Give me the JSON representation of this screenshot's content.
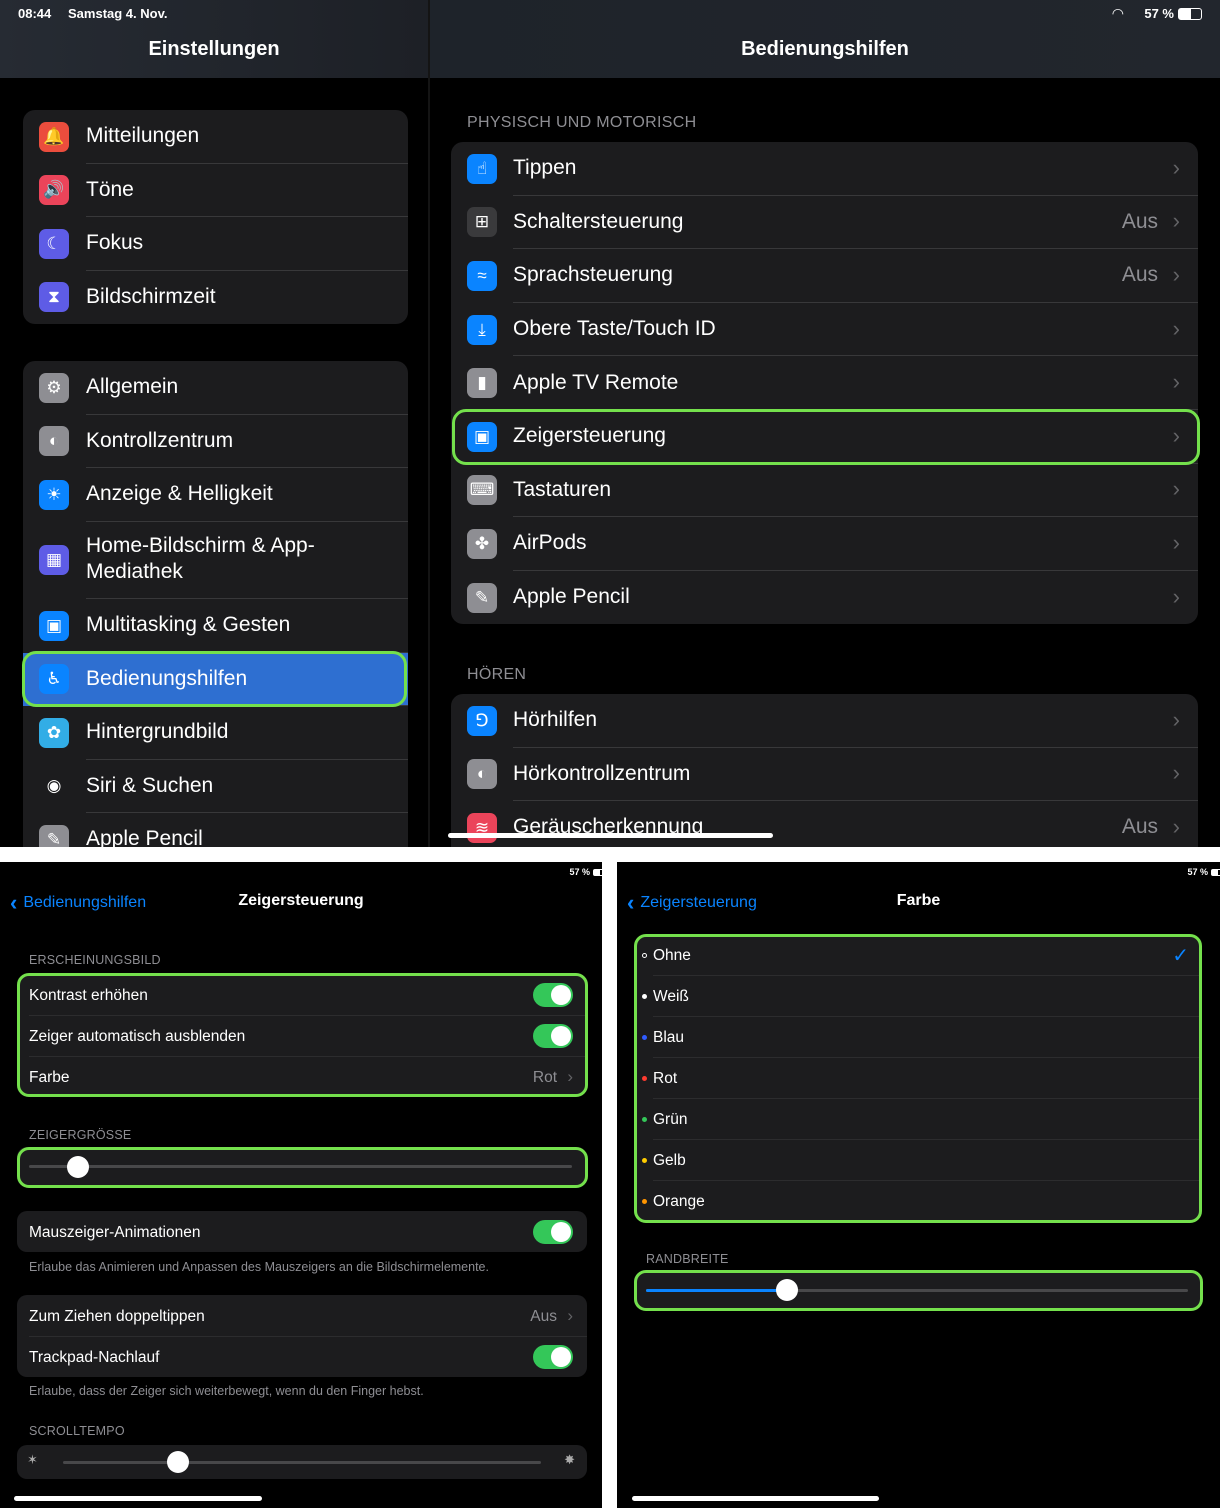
{
  "top": {
    "status": {
      "time": "08:44",
      "date": "Samstag 4. Nov.",
      "battery": "57 %"
    },
    "sidebar_title": "Einstellungen",
    "detail_title": "Bedienungshilfen",
    "sidebar_group1": [
      {
        "label": "Mitteilungen",
        "icon": "bell-icon",
        "color": "#eb4d3d"
      },
      {
        "label": "Töne",
        "icon": "speaker-icon",
        "color": "#eb445a"
      },
      {
        "label": "Fokus",
        "icon": "moon-icon",
        "color": "#5e5ce6"
      },
      {
        "label": "Bildschirmzeit",
        "icon": "hourglass-icon",
        "color": "#5e5ce6"
      }
    ],
    "sidebar_group2": [
      {
        "label": "Allgemein",
        "icon": "gear-icon",
        "color": "#8e8e93"
      },
      {
        "label": "Kontrollzentrum",
        "icon": "switches-icon",
        "color": "#8e8e93"
      },
      {
        "label": "Anzeige & Helligkeit",
        "icon": "sun-icon",
        "color": "#0a84ff"
      },
      {
        "label": "Home-Bildschirm & App-",
        "label2": "Mediathek",
        "icon": "grid-icon",
        "color": "#5e5ce6"
      },
      {
        "label": "Multitasking & Gesten",
        "icon": "multitask-icon",
        "color": "#0a84ff"
      },
      {
        "label": "Bedienungshilfen",
        "icon": "accessibility-icon",
        "color": "#0a84ff"
      },
      {
        "label": "Hintergrundbild",
        "icon": "flower-icon",
        "color": "#32ade6"
      },
      {
        "label": "Siri & Suchen",
        "icon": "siri-icon",
        "color": "#1c1c1e"
      },
      {
        "label": "Apple Pencil",
        "icon": "pencil-icon",
        "color": "#8e8e93"
      }
    ],
    "section_motor": "PHYSISCH UND MOTORISCH",
    "motor_items": [
      {
        "label": "Tippen",
        "value": "",
        "icon": "hand-tap-icon",
        "color": "#0a84ff"
      },
      {
        "label": "Schaltersteuerung",
        "value": "Aus",
        "icon": "switch-grid-icon",
        "color": "#3a3a3c"
      },
      {
        "label": "Sprachsteuerung",
        "value": "Aus",
        "icon": "waveform-icon",
        "color": "#0a84ff"
      },
      {
        "label": "Obere Taste/Touch ID",
        "value": "",
        "icon": "top-button-icon",
        "color": "#0a84ff"
      },
      {
        "label": "Apple TV Remote",
        "value": "",
        "icon": "remote-icon",
        "color": "#8e8e93"
      },
      {
        "label": "Zeigersteuerung",
        "value": "",
        "icon": "pointer-icon",
        "color": "#0a84ff"
      },
      {
        "label": "Tastaturen",
        "value": "",
        "icon": "keyboard-icon",
        "color": "#8e8e93"
      },
      {
        "label": "AirPods",
        "value": "",
        "icon": "airpods-icon",
        "color": "#8e8e93"
      },
      {
        "label": "Apple Pencil",
        "value": "",
        "icon": "pencil-icon",
        "color": "#8e8e93"
      }
    ],
    "section_hearing": "HÖREN",
    "hearing_items": [
      {
        "label": "Hörhilfen",
        "value": "",
        "icon": "ear-icon",
        "color": "#0a84ff"
      },
      {
        "label": "Hörkontrollzentrum",
        "value": "",
        "icon": "switches-icon",
        "color": "#8e8e93"
      },
      {
        "label": "Geräuscherkennung",
        "value": "Aus",
        "icon": "sound-recognition-icon",
        "color": "#eb445a"
      }
    ]
  },
  "pointer": {
    "status": {
      "battery": "57 %"
    },
    "back": "Bedienungshilfen",
    "title": "Zeigersteuerung",
    "section_appearance": "ERSCHEINUNGSBILD",
    "contrast": "Kontrast erhöhen",
    "autohide": "Zeiger automatisch ausblenden",
    "color_label": "Farbe",
    "color_value": "Rot",
    "section_size": "ZEIGERGRÖSSE",
    "size_level": 0.09,
    "animations": "Mauszeiger-Animationen",
    "animations_footer": "Erlaube das Animieren und Anpassen des Mauszeigers an die Bildschirmelemente.",
    "double_tap": "Zum Ziehen doppeltippen",
    "double_tap_value": "Aus",
    "trackpad": "Trackpad-Nachlauf",
    "trackpad_footer": "Erlaube, dass der Zeiger sich weiterbewegt, wenn du den Finger hebst.",
    "section_scroll": "SCROLLTEMPO",
    "scroll_level": 0.24
  },
  "color": {
    "status": {
      "battery": "57 %"
    },
    "back": "Zeigersteuerung",
    "title": "Farbe",
    "options": [
      {
        "label": "Ohne",
        "dot": "#ffffff",
        "selected": true
      },
      {
        "label": "Weiß",
        "dot": "#ffffff",
        "selected": false
      },
      {
        "label": "Blau",
        "dot": "#2f5bff",
        "selected": false
      },
      {
        "label": "Rot",
        "dot": "#ff3b30",
        "selected": false
      },
      {
        "label": "Grün",
        "dot": "#34c759",
        "selected": false
      },
      {
        "label": "Gelb",
        "dot": "#ffcc00",
        "selected": false
      },
      {
        "label": "Orange",
        "dot": "#ff9500",
        "selected": false
      }
    ],
    "section_border": "RANDBREITE",
    "border_level": 0.26,
    "accent": "#0a84ff",
    "highlight": "#74e04c"
  }
}
